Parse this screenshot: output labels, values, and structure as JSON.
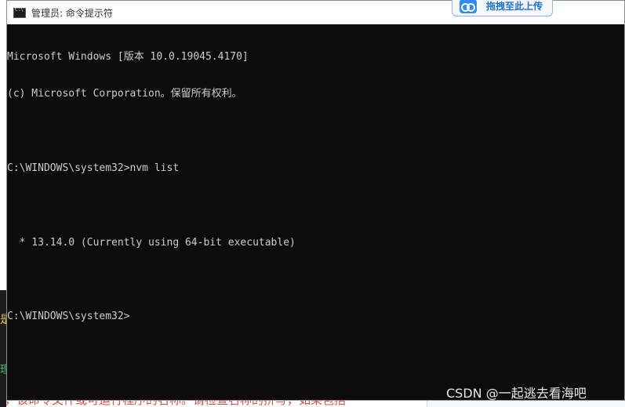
{
  "window": {
    "title": "管理员: 命令提示符",
    "icon": "cmd-icon"
  },
  "upload_button": {
    "label": "拖拽至此上传",
    "icon": "baidu-netdisk-icon",
    "accent": "#2f8af5"
  },
  "console": {
    "lines": [
      "Microsoft Windows [版本 10.0.19045.4170]",
      "(c) Microsoft Corporation。保留所有权利。",
      "",
      "C:\\WINDOWS\\system32>nvm list",
      "",
      "  * 13.14.0 (Currently using 64-bit executable)",
      "",
      "C:\\WINDOWS\\system32>"
    ],
    "background": "#0c0c0c",
    "foreground": "#cccccc"
  },
  "background_fragments": {
    "left_char_1": "是",
    "left_char_2": "理",
    "red_line": "，该命令文件或可运行程序的名称。请检查名称的拼写，如果包括"
  },
  "watermark": "CSDN @一起逃去看海吧"
}
